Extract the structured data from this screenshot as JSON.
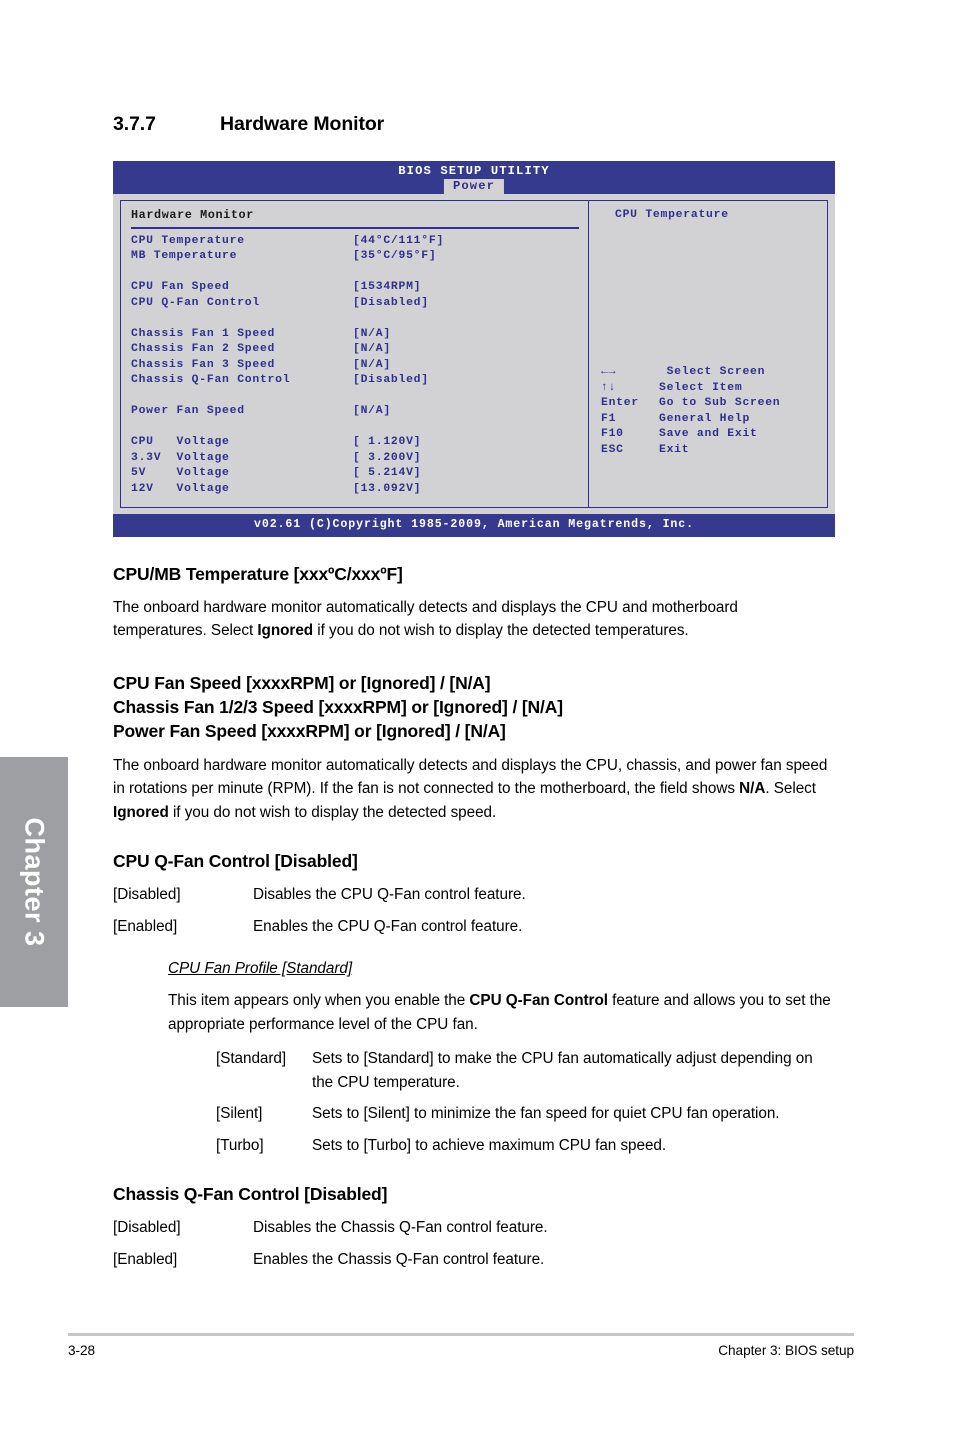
{
  "chapter_tab": {
    "label": "Chapter 3"
  },
  "section": {
    "number": "3.7.7",
    "title": "Hardware Monitor"
  },
  "bios": {
    "title": "BIOS SETUP UTILITY",
    "active_tab": "Power",
    "panel_heading": "Hardware Monitor",
    "items": [
      {
        "label": "CPU Temperature",
        "value": "[44°C/111°F]"
      },
      {
        "label": "MB Temperature",
        "value": "[35°C/95°F]"
      },
      {
        "label": "",
        "value": ""
      },
      {
        "label": "CPU Fan Speed",
        "value": "[1534RPM]"
      },
      {
        "label": "CPU Q-Fan Control",
        "value": "[Disabled]"
      },
      {
        "label": "",
        "value": ""
      },
      {
        "label": "Chassis Fan 1 Speed",
        "value": "[N/A]"
      },
      {
        "label": "Chassis Fan 2 Speed",
        "value": "[N/A]"
      },
      {
        "label": "Chassis Fan 3 Speed",
        "value": "[N/A]"
      },
      {
        "label": "Chassis Q-Fan Control",
        "value": "[Disabled]"
      },
      {
        "label": "",
        "value": ""
      },
      {
        "label": "Power Fan Speed",
        "value": "[N/A]"
      },
      {
        "label": "",
        "value": ""
      },
      {
        "label": "CPU   Voltage",
        "value": "[ 1.120V]"
      },
      {
        "label": "3.3V  Voltage",
        "value": "[ 3.200V]"
      },
      {
        "label": "5V    Voltage",
        "value": "[ 5.214V]"
      },
      {
        "label": "12V   Voltage",
        "value": "[13.092V]"
      }
    ],
    "help_title": "CPU Temperature",
    "legend": [
      {
        "key": "←→",
        "action": " Select Screen"
      },
      {
        "key": "↑↓",
        "action": "Select Item"
      },
      {
        "key": "Enter",
        "action": "Go to Sub Screen"
      },
      {
        "key": "F1",
        "action": "General Help"
      },
      {
        "key": "F10",
        "action": "Save and Exit"
      },
      {
        "key": "ESC",
        "action": "Exit"
      }
    ],
    "footer": "v02.61 (C)Copyright 1985-2009, American Megatrends, Inc.",
    "colors": {
      "titlebar": "#363a8e",
      "panel_bg": "#d2d2d4",
      "text_blue": "#2f2f8f"
    }
  },
  "content": {
    "temp": {
      "heading": "CPU/MB Temperature [xxxºC/xxxºF]",
      "para_1": "The onboard hardware monitor automatically detects and displays the CPU and motherboard",
      "para_2_a": "temperatures. Select ",
      "para_2_bold": "Ignored",
      "para_2_b": " if you do not wish to display the detected temperatures."
    },
    "fanspeed": {
      "heading_1": "CPU Fan Speed [xxxxRPM] or [Ignored] / [N/A]",
      "heading_2": "Chassis Fan 1/2/3 Speed [xxxxRPM] or [Ignored] / [N/A]",
      "heading_3": "Power Fan Speed [xxxxRPM] or [Ignored] / [N/A]",
      "para_a": "The onboard hardware monitor automatically detects and displays the CPU, chassis, and power fan speed in rotations per minute (RPM). If the fan is not connected to the motherboard, the field shows ",
      "para_bold_1": "N/A",
      "para_b": ". Select ",
      "para_bold_2": "Ignored",
      "para_c": " if you do not wish to display the detected speed."
    },
    "cpu_qfan": {
      "heading": "CPU Q-Fan Control [Disabled]",
      "options": [
        {
          "term": "[Disabled]",
          "desc": "Disables the CPU Q-Fan control feature."
        },
        {
          "term": "[Enabled]",
          "desc": "Enables the CPU Q-Fan control feature."
        }
      ],
      "profile": {
        "subhead": "CPU Fan Profile [Standard]",
        "para_a": "This item appears only when you enable the ",
        "para_bold": "CPU Q-Fan Control",
        "para_b": " feature and allows you to set the appropriate performance level of the CPU fan.",
        "options": [
          {
            "term": "[Standard]",
            "desc": "Sets to [Standard] to make the CPU fan automatically adjust depending on the CPU temperature."
          },
          {
            "term": "[Silent]",
            "desc": "Sets to [Silent] to minimize the fan speed for quiet CPU fan operation."
          },
          {
            "term": "[Turbo]",
            "desc": "Sets to [Turbo] to achieve maximum CPU fan speed."
          }
        ]
      }
    },
    "chassis_qfan": {
      "heading": "Chassis Q-Fan Control [Disabled]",
      "options": [
        {
          "term": "[Disabled]",
          "desc": "Disables the Chassis Q-Fan control feature."
        },
        {
          "term": "[Enabled]",
          "desc": "Enables the Chassis Q-Fan control feature."
        }
      ]
    }
  },
  "footer": {
    "page_number": "3-28",
    "chapter_label": "Chapter 3: BIOS setup"
  }
}
